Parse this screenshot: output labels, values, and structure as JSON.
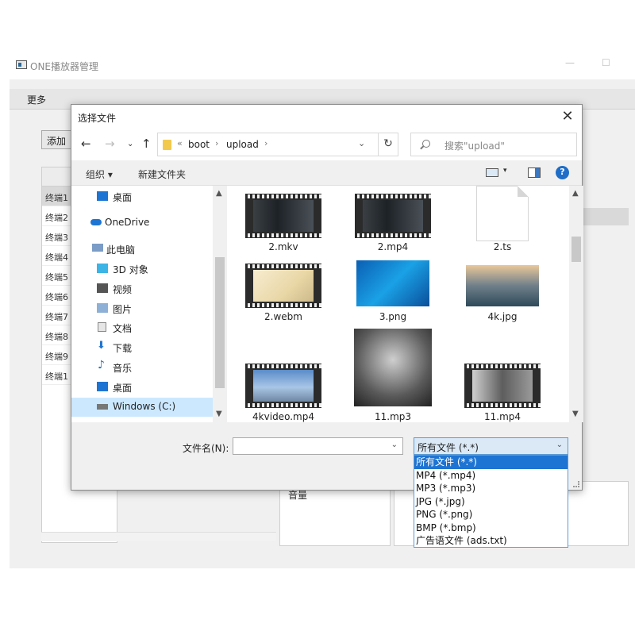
{
  "app": {
    "title": "ONE播放器管理",
    "menu_more": "更多",
    "add_button": "添加",
    "terminals": [
      "终端1",
      "终端2",
      "终端3",
      "终端4",
      "终端5",
      "终端6",
      "终端7",
      "终端8",
      "终端9",
      "终端1"
    ],
    "panel_mid_text": "音量"
  },
  "dialog": {
    "title": "选择文件",
    "breadcrumb": [
      "boot",
      "upload"
    ],
    "search_placeholder": "搜索\"upload\"",
    "cmd_organize": "组织 ▾",
    "cmd_new_folder": "新建文件夹",
    "nav_items": [
      {
        "label": "桌面",
        "icon": "desktop-icon"
      },
      {
        "label": "OneDrive",
        "icon": "cloud-icon"
      },
      {
        "label": "此电脑",
        "icon": "computer-icon"
      },
      {
        "label": "3D 对象",
        "icon": "cube-icon"
      },
      {
        "label": "视频",
        "icon": "video-icon"
      },
      {
        "label": "图片",
        "icon": "picture-icon"
      },
      {
        "label": "文档",
        "icon": "document-icon"
      },
      {
        "label": "下载",
        "icon": "download-icon"
      },
      {
        "label": "音乐",
        "icon": "music-icon"
      },
      {
        "label": "桌面",
        "icon": "desktop-icon"
      },
      {
        "label": "Windows (C:)",
        "icon": "drive-icon"
      }
    ],
    "files": [
      {
        "name": "2.mkv",
        "type": "video"
      },
      {
        "name": "2.mp4",
        "type": "video"
      },
      {
        "name": "2.ts",
        "type": "blank"
      },
      {
        "name": "2.webm",
        "type": "video"
      },
      {
        "name": "3.png",
        "type": "image"
      },
      {
        "name": "4k.jpg",
        "type": "image"
      },
      {
        "name": "4kvideo.mp4",
        "type": "video"
      },
      {
        "name": "11.mp3",
        "type": "image"
      },
      {
        "name": "11.mp4",
        "type": "video"
      }
    ],
    "filename_label": "文件名(N):",
    "filename_value": "",
    "filetype_selected": "所有文件 (*.*)",
    "filetype_options": [
      "所有文件 (*.*)",
      "MP4 (*.mp4)",
      "MP3 (*.mp3)",
      "JPG (*.jpg)",
      "PNG (*.png)",
      "BMP (*.bmp)",
      "广告语文件 (ads.txt)"
    ]
  },
  "colors": {
    "accent": "#1e74d2",
    "selection": "#cce8ff",
    "help": "#1e6ec8"
  }
}
